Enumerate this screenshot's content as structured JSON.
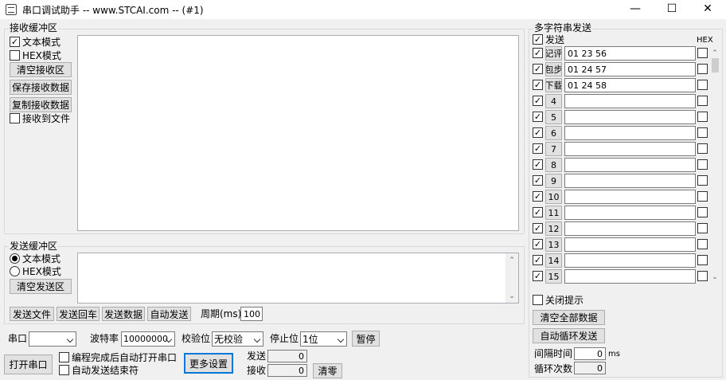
{
  "window": {
    "title": "串口调试助手 -- www.STCAI.com -- (#1)",
    "minimize": "—",
    "maximize": "☐",
    "close": "✕"
  },
  "receive": {
    "group_label": "接收缓冲区",
    "text_mode_label": "文本模式",
    "text_mode_checked": true,
    "hex_mode_label": "HEX模式",
    "hex_mode_checked": false,
    "clear_button": "清空接收区",
    "save_button": "保存接收数据",
    "copy_button": "复制接收数据",
    "to_file_label": "接收到文件",
    "to_file_checked": false
  },
  "send": {
    "group_label": "发送缓冲区",
    "text_mode_label": "文本模式",
    "hex_mode_label": "HEX模式",
    "clear_button": "清空发送区",
    "send_file_button": "发送文件",
    "send_return_button": "发送回车",
    "send_data_button": "发送数据",
    "auto_send_button": "自动发送",
    "period_label": "周期(ms)",
    "period_value": "100"
  },
  "port": {
    "port_label": "串口",
    "port_value": "",
    "baud_label": "波特率",
    "baud_value": "10000000",
    "parity_label": "校验位",
    "parity_value": "无校验",
    "stopbits_label": "停止位",
    "stopbits_value": "1位",
    "pause_button": "暂停",
    "open_button": "打开串口",
    "auto_open_label": "编程完成后自动打开串口",
    "auto_send_end_label": "自动发送结束符",
    "more_settings_button": "更多设置",
    "sent_label": "发送",
    "sent_value": "0",
    "recv_label": "接收",
    "recv_value": "0",
    "zero_button": "清零"
  },
  "multi": {
    "group_label": "多字符串发送",
    "send_header": "发送",
    "hex_header": "HEX",
    "rows": [
      {
        "label": "记评",
        "value": "01 23 56"
      },
      {
        "label": "包步",
        "value": "01 24 57"
      },
      {
        "label": "下载",
        "value": "01 24 58"
      },
      {
        "label": "4",
        "value": ""
      },
      {
        "label": "5",
        "value": ""
      },
      {
        "label": "6",
        "value": ""
      },
      {
        "label": "7",
        "value": ""
      },
      {
        "label": "8",
        "value": ""
      },
      {
        "label": "9",
        "value": ""
      },
      {
        "label": "10",
        "value": ""
      },
      {
        "label": "11",
        "value": ""
      },
      {
        "label": "12",
        "value": ""
      },
      {
        "label": "13",
        "value": ""
      },
      {
        "label": "14",
        "value": ""
      },
      {
        "label": "15",
        "value": ""
      }
    ],
    "close_hint_label": "关闭提示",
    "clear_all_button": "清空全部数据",
    "auto_loop_button": "自动循环发送",
    "interval_label": "间隔时间",
    "interval_value": "0",
    "interval_unit": "ms",
    "loop_count_label": "循环次数",
    "loop_count_value": "0"
  }
}
